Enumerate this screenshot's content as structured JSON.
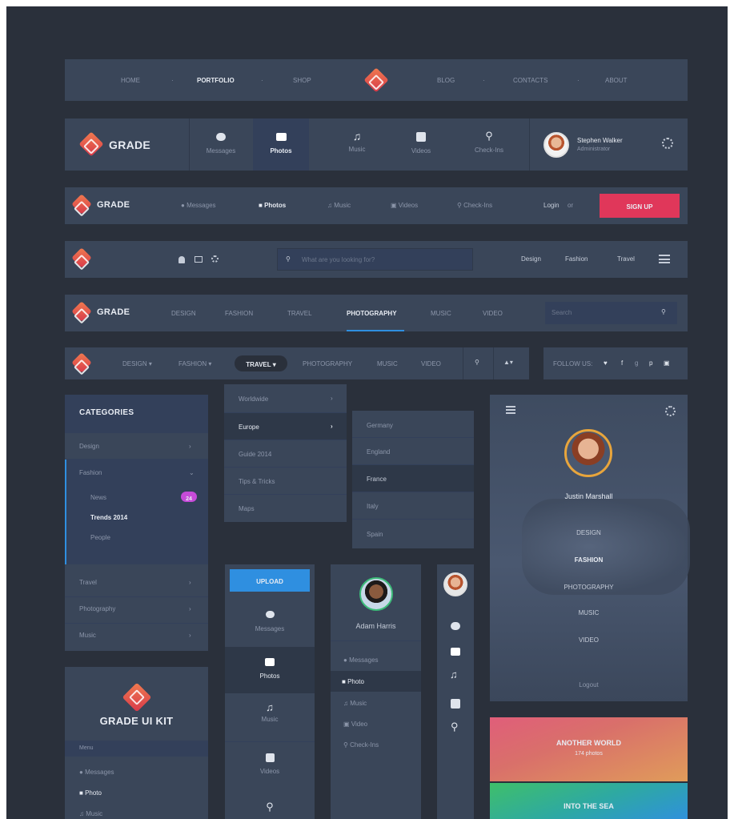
{
  "nav1": {
    "items_left": [
      "HOME",
      "PORTFOLIO",
      "SHOP"
    ],
    "items_right": [
      "BLOG",
      "CONTACTS",
      "ABOUT"
    ],
    "active": "PORTFOLIO"
  },
  "nav2": {
    "brand": "GRADE",
    "tabs": [
      "Messages",
      "Photos",
      "Music",
      "Videos",
      "Check-Ins"
    ],
    "active": "Photos",
    "user_name": "Stephen Walker",
    "user_role": "Administrator"
  },
  "nav3": {
    "brand": "GRADE",
    "tabs": [
      "Messages",
      "Photos",
      "Music",
      "Videos",
      "Check-Ins"
    ],
    "login": "Login",
    "or": "or",
    "signup": "SIGN UP"
  },
  "nav4": {
    "search_placeholder": "What are you looking for?",
    "links": [
      "Design",
      "Fashion",
      "Travel"
    ]
  },
  "nav5": {
    "brand": "GRADE",
    "items": [
      "DESIGN",
      "FASHION",
      "TRAVEL",
      "PHOTOGRAPHY",
      "MUSIC",
      "VIDEO"
    ],
    "active": "PHOTOGRAPHY",
    "search_placeholder": "Search"
  },
  "nav6": {
    "items": [
      "DESIGN",
      "FASHION",
      "TRAVEL",
      "PHOTOGRAPHY",
      "MUSIC",
      "VIDEO"
    ],
    "active": "TRAVEL",
    "follow": "FOLLOW US:"
  },
  "categories": {
    "title": "CATEGORIES",
    "items": [
      "Design",
      "Fashion",
      "Travel",
      "Photography",
      "Music"
    ],
    "sub": [
      "News",
      "Trends 2014",
      "People"
    ],
    "badge": "24"
  },
  "dropdown1": {
    "items": [
      "Worldwide",
      "Europe",
      "Guide 2014",
      "Tips & Tricks",
      "Maps"
    ],
    "active": "Europe"
  },
  "dropdown2": {
    "items": [
      "Germany",
      "England",
      "France",
      "Italy",
      "Spain"
    ],
    "active": "France"
  },
  "profile_panel": {
    "name": "Justin Marshall",
    "items": [
      "DESIGN",
      "FASHION",
      "PHOTOGRAPHY",
      "MUSIC",
      "VIDEO"
    ],
    "active": "FASHION",
    "logout": "Logout"
  },
  "upload_panel": {
    "upload": "UPLOAD",
    "items": [
      "Messages",
      "Photos",
      "Music",
      "Videos"
    ],
    "active": "Photos"
  },
  "adam_panel": {
    "name": "Adam Harris",
    "items": [
      "Messages",
      "Photo",
      "Music",
      "Video",
      "Check-Ins"
    ],
    "active": "Photo"
  },
  "kit_panel": {
    "title": "GRADE UI KIT",
    "section": "Menu",
    "items": [
      "Messages",
      "Photo",
      "Music"
    ],
    "active": "Photo"
  },
  "cards": [
    {
      "title": "ANOTHER WORLD",
      "sub": "174 photos"
    },
    {
      "title": "INTO THE SEA",
      "sub": ""
    }
  ],
  "colors": {
    "background": "#2a303b",
    "panel": "#3a4659",
    "accent_red": "#e0375a",
    "accent_blue": "#2f8fe0",
    "badge": "#c64bd9"
  }
}
